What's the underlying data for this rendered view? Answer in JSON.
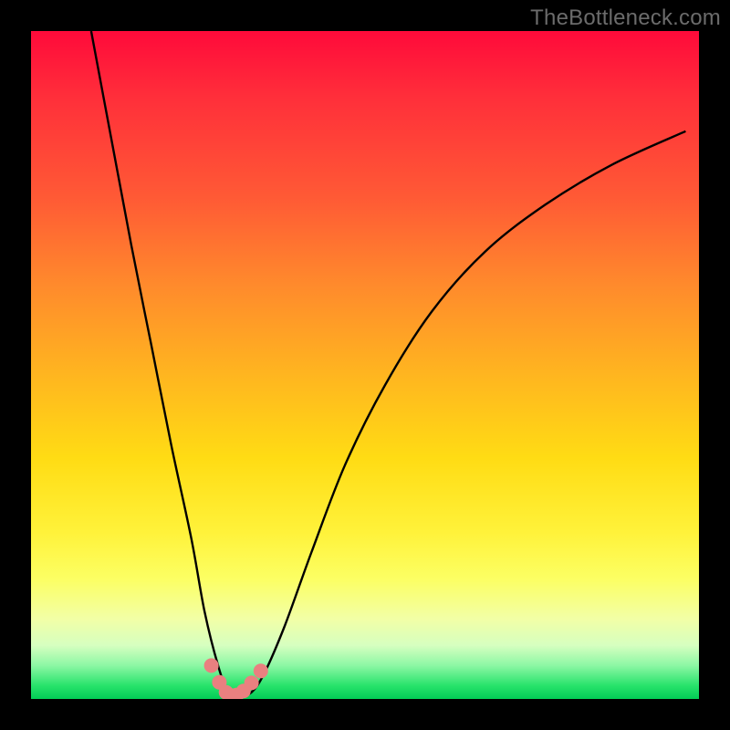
{
  "watermark": "TheBottleneck.com",
  "chart_data": {
    "type": "line",
    "title": "",
    "xlabel": "",
    "ylabel": "",
    "xlim": [
      0,
      100
    ],
    "ylim": [
      0,
      100
    ],
    "background_gradient": {
      "top": "#ff0a3a",
      "middle": "#ffdc14",
      "bottom": "#02cc56"
    },
    "series": [
      {
        "name": "bottleneck-curve",
        "color": "#000000",
        "x": [
          9,
          12,
          15,
          18,
          21,
          24,
          26,
          28,
          29.5,
          31,
          33,
          35,
          38,
          42,
          47,
          53,
          60,
          68,
          77,
          87,
          98
        ],
        "y": [
          100,
          84,
          68,
          53,
          38,
          24,
          13,
          5,
          1,
          0.5,
          1,
          4,
          11,
          22,
          35,
          47,
          58,
          67,
          74,
          80,
          85
        ]
      },
      {
        "name": "highlight-dots",
        "type": "scatter",
        "color": "#e98080",
        "x": [
          27.0,
          28.2,
          29.2,
          30.0,
          30.8,
          31.8,
          33.0,
          34.4
        ],
        "y": [
          5.0,
          2.5,
          1.0,
          0.5,
          0.6,
          1.2,
          2.4,
          4.2
        ]
      }
    ],
    "annotations": []
  }
}
